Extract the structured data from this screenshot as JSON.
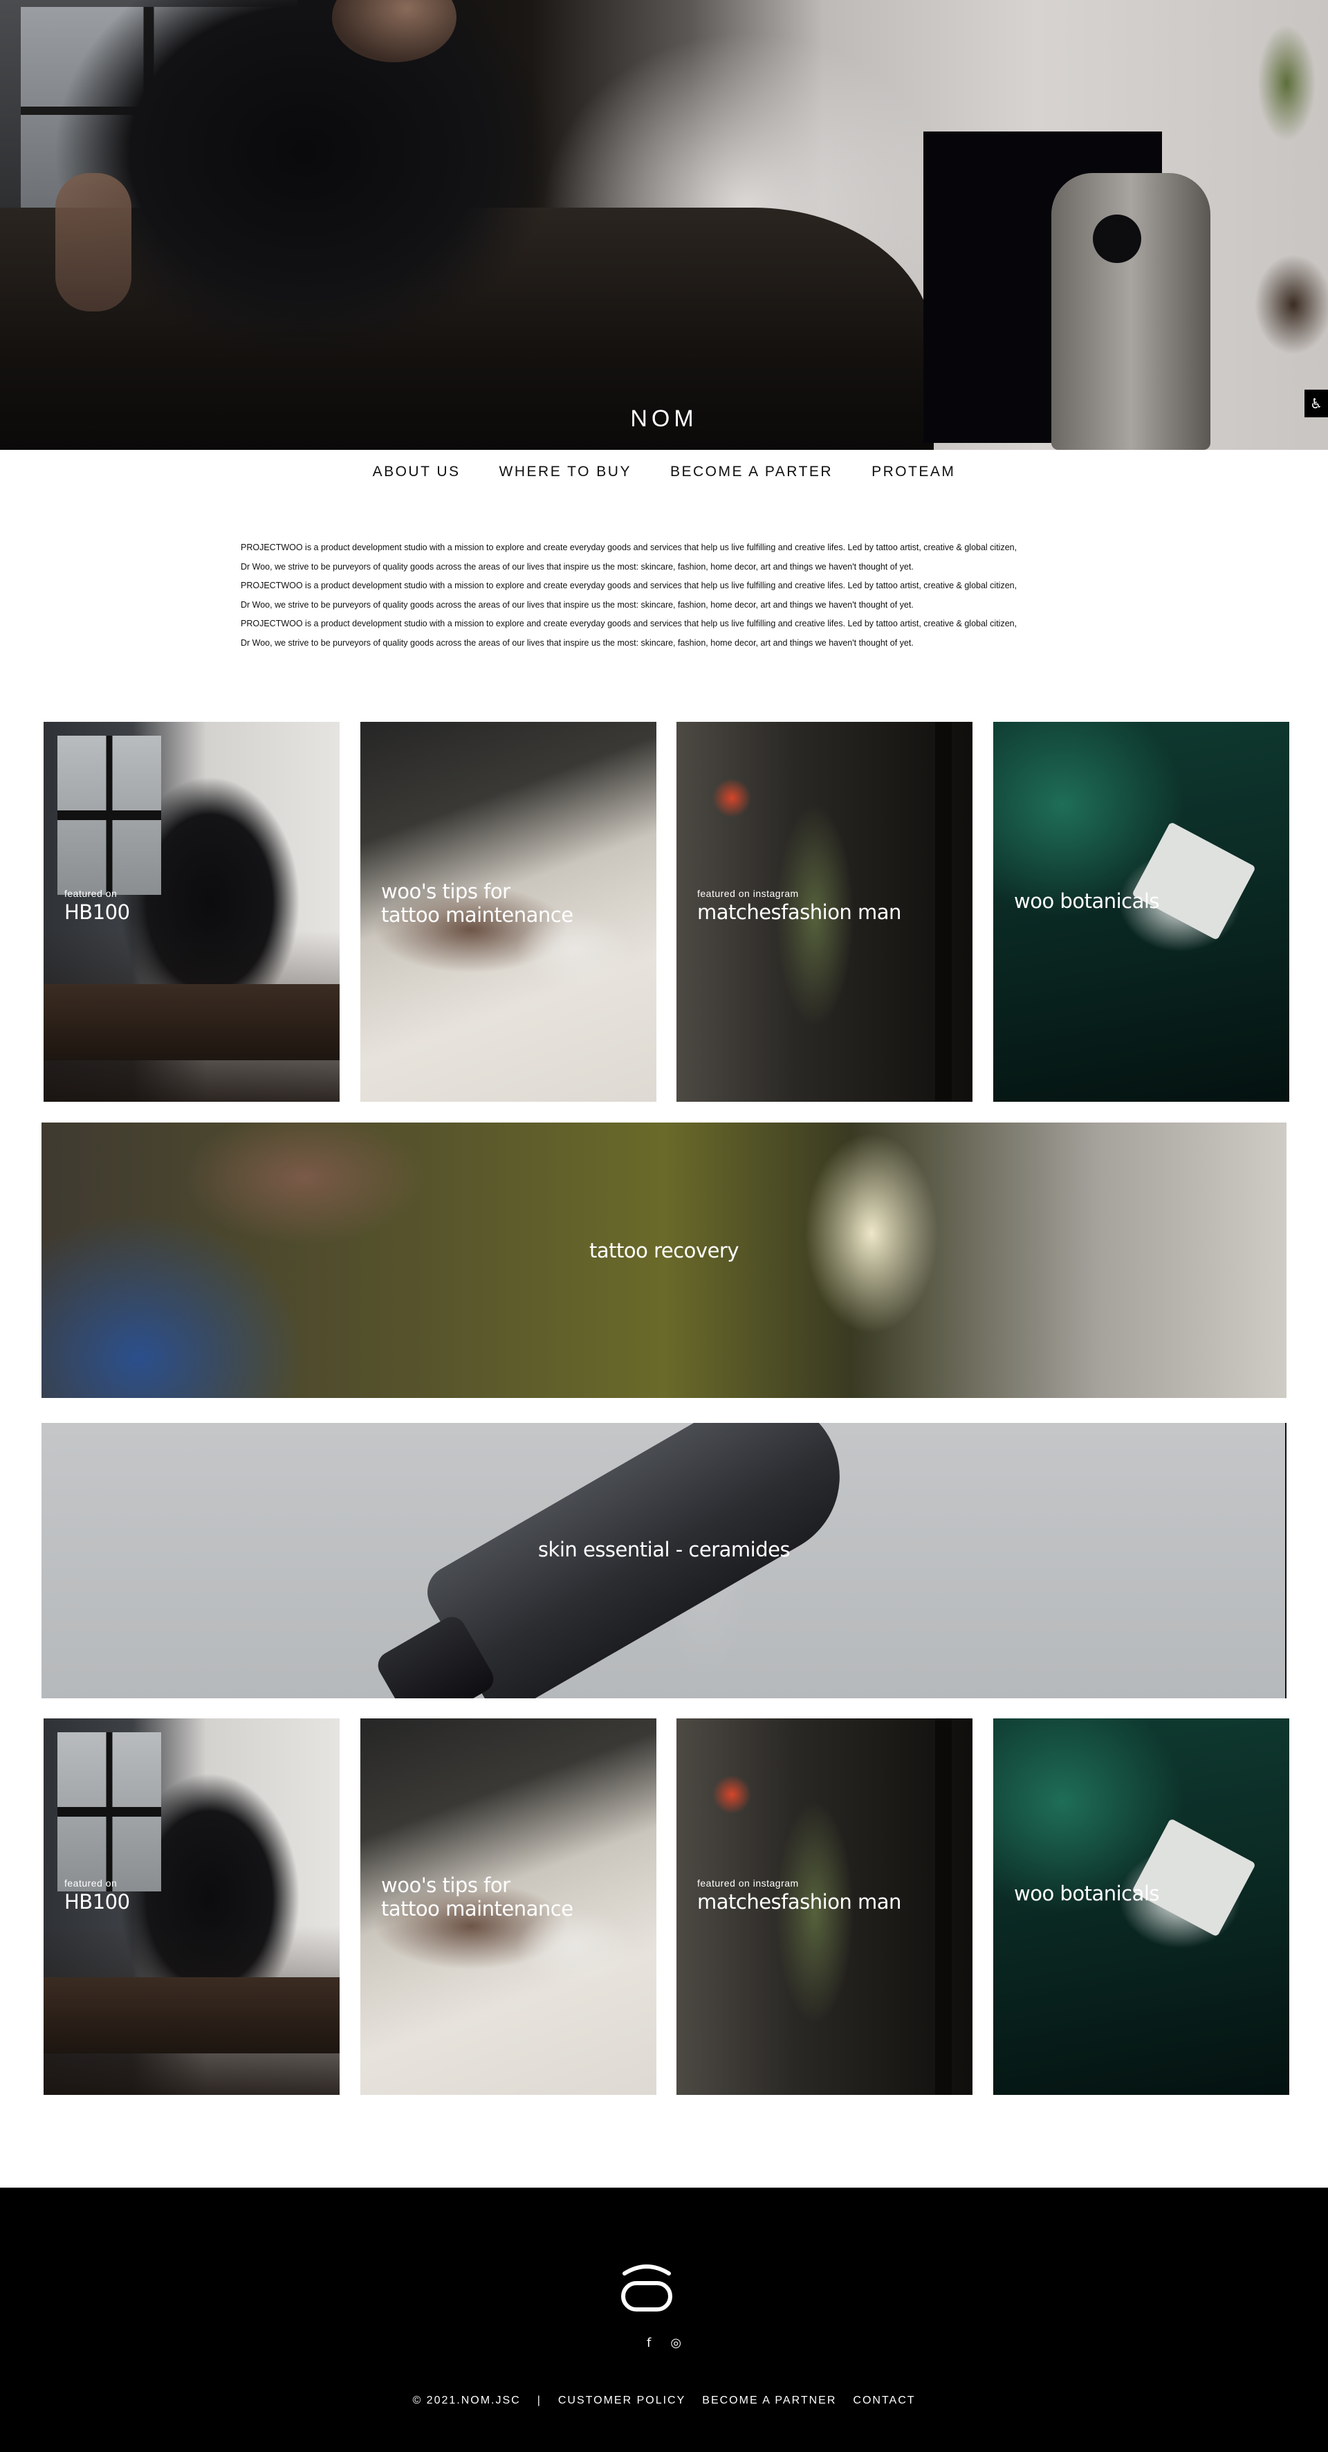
{
  "hero": {
    "brand": "NOM",
    "accessibility_icon": "accessibility-icon"
  },
  "nav": {
    "items": [
      {
        "label": "ABOUT US"
      },
      {
        "label": "WHERE TO BUY"
      },
      {
        "label": "BECOME A PARTER"
      },
      {
        "label": "PROTEAM"
      }
    ]
  },
  "intro": {
    "lines": [
      "PROJECTWOO is a product development studio with a mission to explore and create everyday goods and services that help us live fulfilling and creative lifes. Led by tattoo artist, creative & global citizen,",
      "Dr Woo, we strive to be purveyors of quality goods across the areas of our lives that inspire us the most: skincare, fashion, home decor, art and things we haven't thought of yet.",
      "PROJECTWOO is a product development studio with a mission to explore and create everyday goods and services that help us live fulfilling and creative lifes. Led by tattoo artist, creative & global citizen,",
      "Dr Woo, we strive to be purveyors of quality goods across the areas of our lives that inspire us the most: skincare, fashion, home decor, art and things we haven't thought of yet.",
      "PROJECTWOO is a product development studio with a mission to explore and create everyday goods and services that help us live fulfilling and creative lifes. Led by tattoo artist, creative & global citizen,",
      "Dr Woo, we strive to be purveyors of quality goods across the areas of our lives that inspire us the most: skincare, fashion, home decor, art and things we haven't thought of yet."
    ]
  },
  "tiles_row1": [
    {
      "small": "featured on",
      "big": "HB100"
    },
    {
      "small": "",
      "big": "woo's tips for\ntattoo maintenance"
    },
    {
      "small": "featured on instagram",
      "big": "matchesfashion man"
    },
    {
      "small": "",
      "big": "woo botanicals"
    }
  ],
  "banner_recovery": {
    "label": "tattoo recovery"
  },
  "banner_skin": {
    "label": "skin essential - ceramides"
  },
  "tiles_row2": [
    {
      "small": "featured on",
      "big": "HB100"
    },
    {
      "small": "",
      "big": "woo's tips for\ntattoo maintenance"
    },
    {
      "small": "featured on instagram",
      "big": "matchesfashion man"
    },
    {
      "small": "",
      "big": "woo botanicals"
    }
  ],
  "footer": {
    "social": [
      {
        "icon": "facebook-icon",
        "glyph": "f"
      },
      {
        "icon": "instagram-icon",
        "glyph": "◎"
      }
    ],
    "copyright": "© 2021.NOM.JSC",
    "separator": "|",
    "links": [
      "CUSTOMER POLICY",
      "BECOME A PARTNER",
      "CONTACT"
    ]
  }
}
